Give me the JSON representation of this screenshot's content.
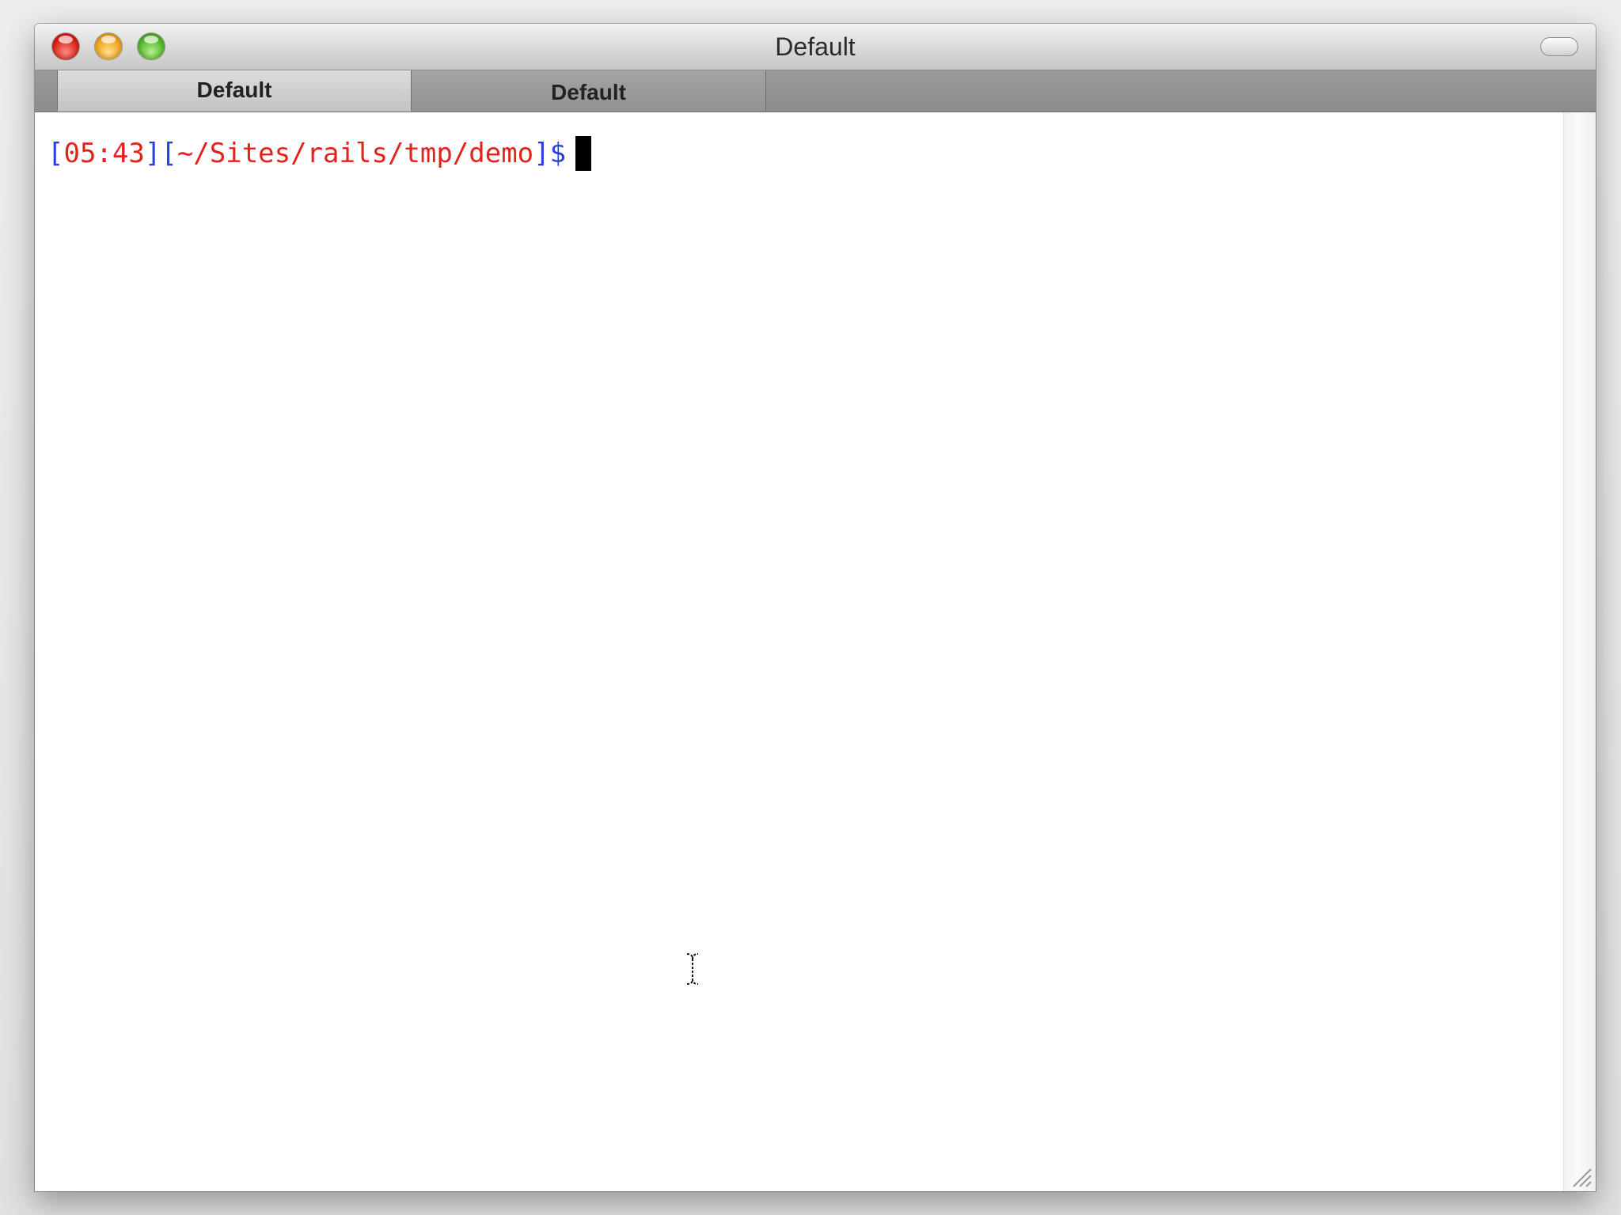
{
  "window": {
    "title": "Default"
  },
  "tabs": [
    {
      "label": "Default",
      "active": true
    },
    {
      "label": "Default",
      "active": false
    }
  ],
  "terminal": {
    "prompt": {
      "open_bracket_1": "[",
      "time": "05:43",
      "close_bracket_1": "]",
      "open_bracket_2": "[",
      "path": "~/Sites/rails/tmp/demo",
      "close_bracket_2": "]",
      "symbol": "$"
    }
  },
  "icons": {
    "close": "close-icon",
    "minimize": "minimize-icon",
    "zoom": "zoom-icon",
    "toolbar_toggle": "toolbar-toggle-icon",
    "text_cursor": "ibeam-cursor-icon",
    "resize": "resize-grip-icon"
  },
  "colors": {
    "prompt_blue": "#2a3de0",
    "prompt_red": "#e0241c",
    "terminal_background": "#ffffff"
  }
}
